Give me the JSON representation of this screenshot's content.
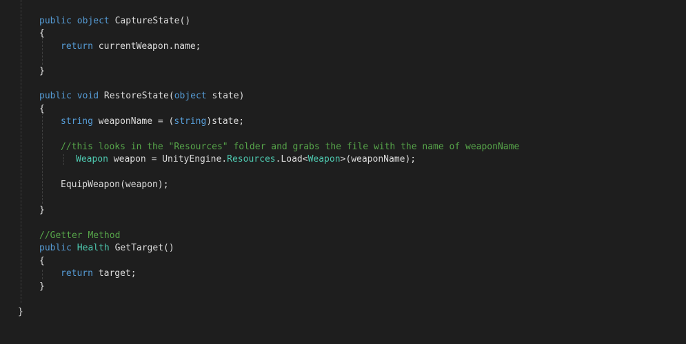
{
  "theme": {
    "background": "#1e1e1e",
    "keyword_color": "#569cd6",
    "type_color": "#4ec9b0",
    "plain_color": "#dcdcdc",
    "comment_color": "#57a64a"
  },
  "code": {
    "lines": [
      {
        "t": 0,
        "tokens": [
          [
            "kw",
            "public"
          ],
          [
            "plain",
            " "
          ],
          [
            "kw",
            "object"
          ],
          [
            "plain",
            " CaptureState()"
          ]
        ]
      },
      {
        "t": 1,
        "tokens": [
          [
            "plain",
            "{"
          ]
        ]
      },
      {
        "t": 2,
        "tokens": [
          [
            "kw",
            "return"
          ],
          [
            "plain",
            " currentWeapon.name;"
          ]
        ]
      },
      {
        "t": 3,
        "tokens": []
      },
      {
        "t": 4,
        "tokens": [
          [
            "plain",
            "}"
          ]
        ]
      },
      {
        "t": 5,
        "tokens": []
      },
      {
        "t": 6,
        "tokens": [
          [
            "kw",
            "public"
          ],
          [
            "plain",
            " "
          ],
          [
            "kw",
            "void"
          ],
          [
            "plain",
            " RestoreState("
          ],
          [
            "kw",
            "object"
          ],
          [
            "plain",
            " state)"
          ]
        ]
      },
      {
        "t": 7,
        "tokens": [
          [
            "plain",
            "{"
          ]
        ]
      },
      {
        "t": 8,
        "tokens": [
          [
            "kw",
            "string"
          ],
          [
            "plain",
            " weaponName = ("
          ],
          [
            "kw",
            "string"
          ],
          [
            "plain",
            ")state;"
          ]
        ]
      },
      {
        "t": 9,
        "tokens": []
      },
      {
        "t": 10,
        "tokens": [
          [
            "comment",
            "//this looks in the \"Resources\" folder and grabs the file with the name of weaponName"
          ]
        ]
      },
      {
        "t": 11,
        "tokens": [
          [
            "type",
            "Weapon"
          ],
          [
            "plain",
            " weapon = UnityEngine."
          ],
          [
            "type",
            "Resources"
          ],
          [
            "plain",
            ".Load<"
          ],
          [
            "type",
            "Weapon"
          ],
          [
            "plain",
            ">(weaponName);"
          ]
        ]
      },
      {
        "t": 12,
        "tokens": []
      },
      {
        "t": 13,
        "tokens": [
          [
            "plain",
            "EquipWeapon(weapon);"
          ]
        ]
      },
      {
        "t": 14,
        "tokens": []
      },
      {
        "t": 15,
        "tokens": [
          [
            "plain",
            "}"
          ]
        ]
      },
      {
        "t": 16,
        "tokens": []
      },
      {
        "t": 17,
        "tokens": [
          [
            "comment",
            "//Getter Method"
          ]
        ]
      },
      {
        "t": 18,
        "tokens": [
          [
            "kw",
            "public"
          ],
          [
            "plain",
            " "
          ],
          [
            "type",
            "Health"
          ],
          [
            "plain",
            " GetTarget()"
          ]
        ]
      },
      {
        "t": 19,
        "tokens": [
          [
            "plain",
            "{"
          ]
        ]
      },
      {
        "t": 20,
        "tokens": [
          [
            "kw",
            "return"
          ],
          [
            "plain",
            " target;"
          ]
        ]
      },
      {
        "t": 21,
        "tokens": [
          [
            "plain",
            "}"
          ]
        ]
      },
      {
        "t": 22,
        "tokens": []
      },
      {
        "t": 23,
        "tokens": [
          [
            "plain",
            "}"
          ]
        ]
      }
    ]
  }
}
